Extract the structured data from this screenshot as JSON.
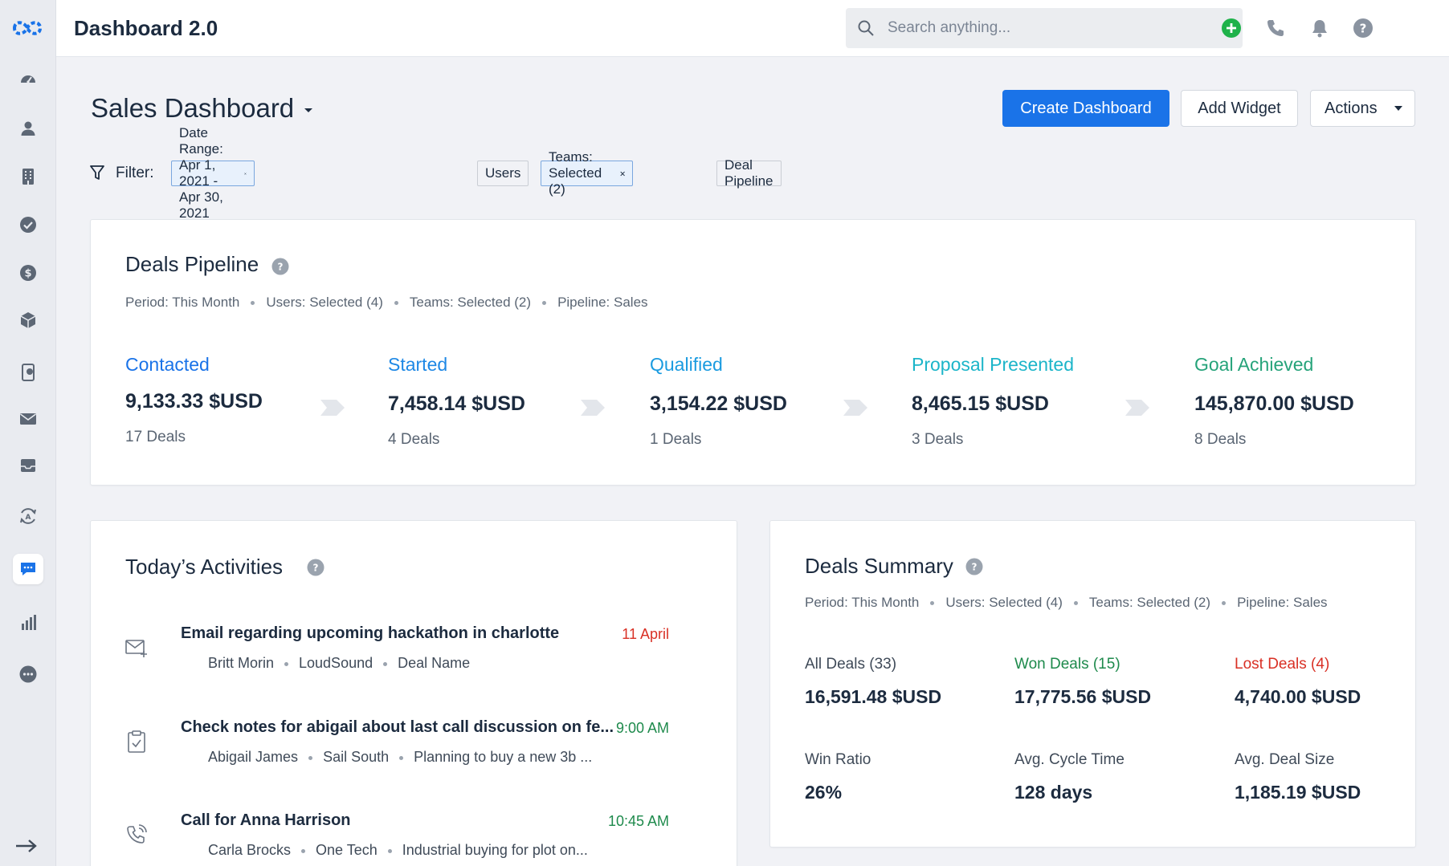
{
  "app": {
    "title": "Dashboard 2.0"
  },
  "search": {
    "placeholder": "Search anything..."
  },
  "sidebar": {
    "items": [
      {
        "name": "dashboard",
        "icon": "speedometer-icon"
      },
      {
        "name": "contacts",
        "icon": "person-icon"
      },
      {
        "name": "accounts",
        "icon": "building-icon"
      },
      {
        "name": "tasks",
        "icon": "check-circle-icon"
      },
      {
        "name": "deals",
        "icon": "dollar-circle-icon"
      },
      {
        "name": "products",
        "icon": "box-icon"
      },
      {
        "name": "phone",
        "icon": "phone-book-icon"
      },
      {
        "name": "mail",
        "icon": "envelope-icon"
      },
      {
        "name": "inbox",
        "icon": "inbox-icon"
      },
      {
        "name": "automation",
        "icon": "auto-icon"
      },
      {
        "name": "chat",
        "icon": "chat-icon",
        "active": true
      },
      {
        "name": "reports",
        "icon": "bar-chart-icon"
      },
      {
        "name": "more",
        "icon": "more-icon"
      }
    ]
  },
  "header": {
    "page_title": "Sales Dashboard",
    "create_label": "Create Dashboard",
    "add_widget_label": "Add Widget",
    "actions_label": "Actions"
  },
  "filter": {
    "label": "Filter:",
    "chips": [
      {
        "label": "Date Range: Apr 1, 2021 - Apr 30, 2021",
        "selected": true,
        "removable": true
      },
      {
        "label": "Users",
        "selected": false,
        "removable": false
      },
      {
        "label": "Teams: Selected (2)",
        "selected": true,
        "removable": true
      },
      {
        "label": "Deal Pipeline",
        "selected": false,
        "removable": false
      }
    ]
  },
  "pipeline": {
    "title": "Deals Pipeline",
    "meta": [
      "Period: This Month",
      "Users: Selected (4)",
      "Teams: Selected (2)",
      "Pipeline: Sales"
    ],
    "stages": [
      {
        "name": "Contacted",
        "value": "9,133.33 $USD",
        "count": "17 Deals",
        "color": "#1a73e8"
      },
      {
        "name": "Started",
        "value": "7,458.14 $USD",
        "count": "4 Deals",
        "color": "#1e88e5"
      },
      {
        "name": "Qualified",
        "value": "3,154.22 $USD",
        "count": "1 Deals",
        "color": "#1a9be0"
      },
      {
        "name": "Proposal Presented",
        "value": "8,465.15 $USD",
        "count": "3 Deals",
        "color": "#1cb5c9"
      },
      {
        "name": "Goal Achieved",
        "value": "145,870.00 $USD",
        "count": "8 Deals",
        "color": "#26a37a"
      }
    ]
  },
  "activities": {
    "title": "Today’s Activities",
    "items": [
      {
        "icon": "email-add-icon",
        "title": "Email regarding upcoming hackathon in charlotte",
        "time": "11 April",
        "time_color": "#d93025",
        "meta": [
          "Britt Morin",
          "LoudSound",
          "Deal Name"
        ]
      },
      {
        "icon": "clipboard-check-icon",
        "title": "Check notes for abigail about last call discussion on fe...",
        "time": "9:00 AM",
        "time_color": "#1e8a4c",
        "meta": [
          "Abigail James",
          "Sail South",
          "Planning to buy a new 3b ..."
        ]
      },
      {
        "icon": "phone-call-icon",
        "title": "Call for Anna Harrison",
        "time": "10:45 AM",
        "time_color": "#1e8a4c",
        "meta": [
          "Carla Brocks",
          "One Tech",
          "Industrial buying for plot on..."
        ]
      }
    ]
  },
  "summary": {
    "title": "Deals Summary",
    "meta": [
      "Period: This Month",
      "Users: Selected (4)",
      "Teams: Selected (2)",
      "Pipeline: Sales"
    ],
    "cells": [
      {
        "label": "All Deals (33)",
        "value": "16,591.48 $USD",
        "color": "#3f4a58"
      },
      {
        "label": "Won Deals (15)",
        "value": "17,775.56 $USD",
        "color": "#1e8a4c"
      },
      {
        "label": "Lost Deals (4)",
        "value": "4,740.00 $USD",
        "color": "#d93025"
      },
      {
        "label": "Win Ratio",
        "value": "26%",
        "color": "#3f4a58"
      },
      {
        "label": "Avg. Cycle Time",
        "value": "128 days",
        "color": "#3f4a58"
      },
      {
        "label": "Avg. Deal Size",
        "value": "1,185.19 $USD",
        "color": "#3f4a58"
      }
    ]
  },
  "colors": {
    "accent": "#1a73e8",
    "green": "#1e8a4c",
    "red": "#d93025",
    "add_green": "#1fb24a"
  }
}
